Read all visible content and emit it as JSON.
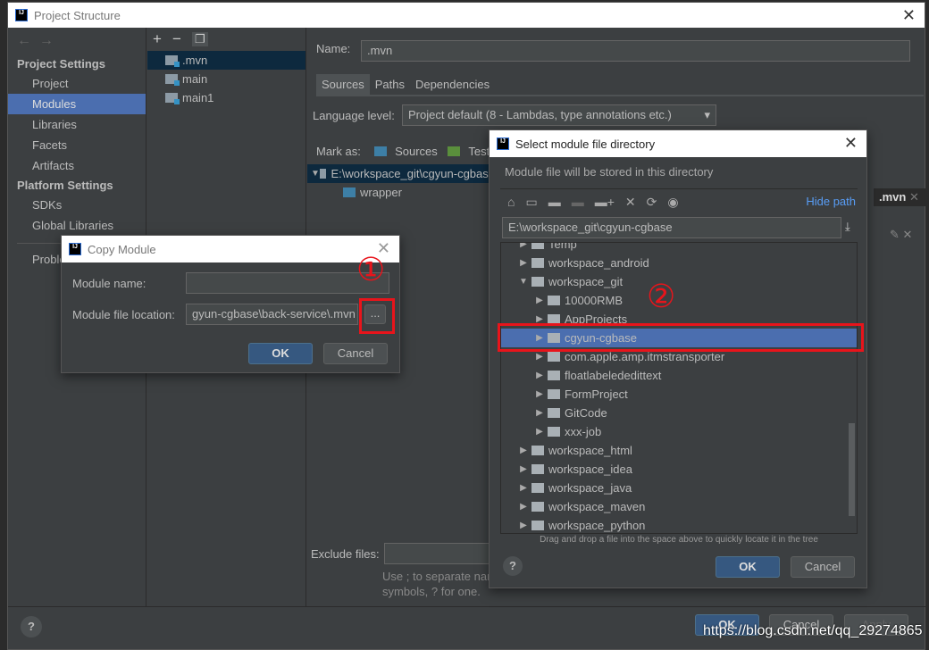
{
  "window": {
    "title": "Project Structure"
  },
  "sidebar": {
    "section1": "Project Settings",
    "items1": [
      "Project",
      "Modules",
      "Libraries",
      "Facets",
      "Artifacts"
    ],
    "section2": "Platform Settings",
    "items2": [
      "SDKs",
      "Global Libraries"
    ],
    "problems": "Problems"
  },
  "modules": [
    ".mvn",
    "main",
    "main1"
  ],
  "main": {
    "name_label": "Name:",
    "name_value": ".mvn",
    "tabs": [
      "Sources",
      "Paths",
      "Dependencies"
    ],
    "language_label": "Language level:",
    "language_value": "Project default",
    "language_hint": "(8 - Lambdas, type annotations etc.)",
    "mark_as": "Mark as:",
    "mark_sources": "Sources",
    "mark_tests": "Tests",
    "root_path": "E:\\workspace_git\\cgyun-cgbase",
    "child": "wrapper",
    "exclude_label": "Exclude files:",
    "hint1": "Use ; to separate name patterns, * for any number of",
    "hint2": "symbols, ? for one.",
    "side_tab": ".mvn"
  },
  "footer": {
    "ok": "OK",
    "cancel": "Cancel",
    "apply": "Apply",
    "help": "?"
  },
  "copy_module": {
    "title": "Copy Module",
    "name_label": "Module name:",
    "name_value": "",
    "location_label": "Module file location:",
    "location_value": "gyun-cgbase\\back-service\\.mvn",
    "browse": "...",
    "ok": "OK",
    "cancel": "Cancel",
    "annotation": "①"
  },
  "select_dir": {
    "title": "Select module file directory",
    "description": "Module file will be stored in this directory",
    "hide_path": "Hide path",
    "path": "E:\\workspace_git\\cgyun-cgbase",
    "annotation": "②",
    "tree": [
      {
        "label": "Temp",
        "level": 1,
        "state": "collapsed"
      },
      {
        "label": "workspace_android",
        "level": 1,
        "state": "collapsed"
      },
      {
        "label": "workspace_git",
        "level": 1,
        "state": "expanded"
      },
      {
        "label": "10000RMB",
        "level": 2,
        "state": "collapsed"
      },
      {
        "label": "AppProjects",
        "level": 2,
        "state": "collapsed"
      },
      {
        "label": "cgyun-cgbase",
        "level": 2,
        "state": "collapsed",
        "selected": true
      },
      {
        "label": "com.apple.amp.itmstransporter",
        "level": 2,
        "state": "collapsed"
      },
      {
        "label": "floatlabelededittext",
        "level": 2,
        "state": "collapsed"
      },
      {
        "label": "FormProject",
        "level": 2,
        "state": "collapsed"
      },
      {
        "label": "GitCode",
        "level": 2,
        "state": "collapsed"
      },
      {
        "label": "xxx-job",
        "level": 2,
        "state": "collapsed"
      },
      {
        "label": "workspace_html",
        "level": 1,
        "state": "collapsed"
      },
      {
        "label": "workspace_idea",
        "level": 1,
        "state": "collapsed"
      },
      {
        "label": "workspace_java",
        "level": 1,
        "state": "collapsed"
      },
      {
        "label": "workspace_maven",
        "level": 1,
        "state": "collapsed"
      },
      {
        "label": "workspace_python",
        "level": 1,
        "state": "collapsed"
      }
    ],
    "drag_hint": "Drag and drop a file into the space above to quickly locate it in the tree",
    "ok": "OK",
    "cancel": "Cancel",
    "help": "?"
  },
  "watermark": "https://blog.csdn.net/qq_29274865",
  "colors": {
    "selection": "#4b6eaf",
    "annotation_red": "#e8141b",
    "primary_button": "#365880",
    "link": "#589df6"
  }
}
